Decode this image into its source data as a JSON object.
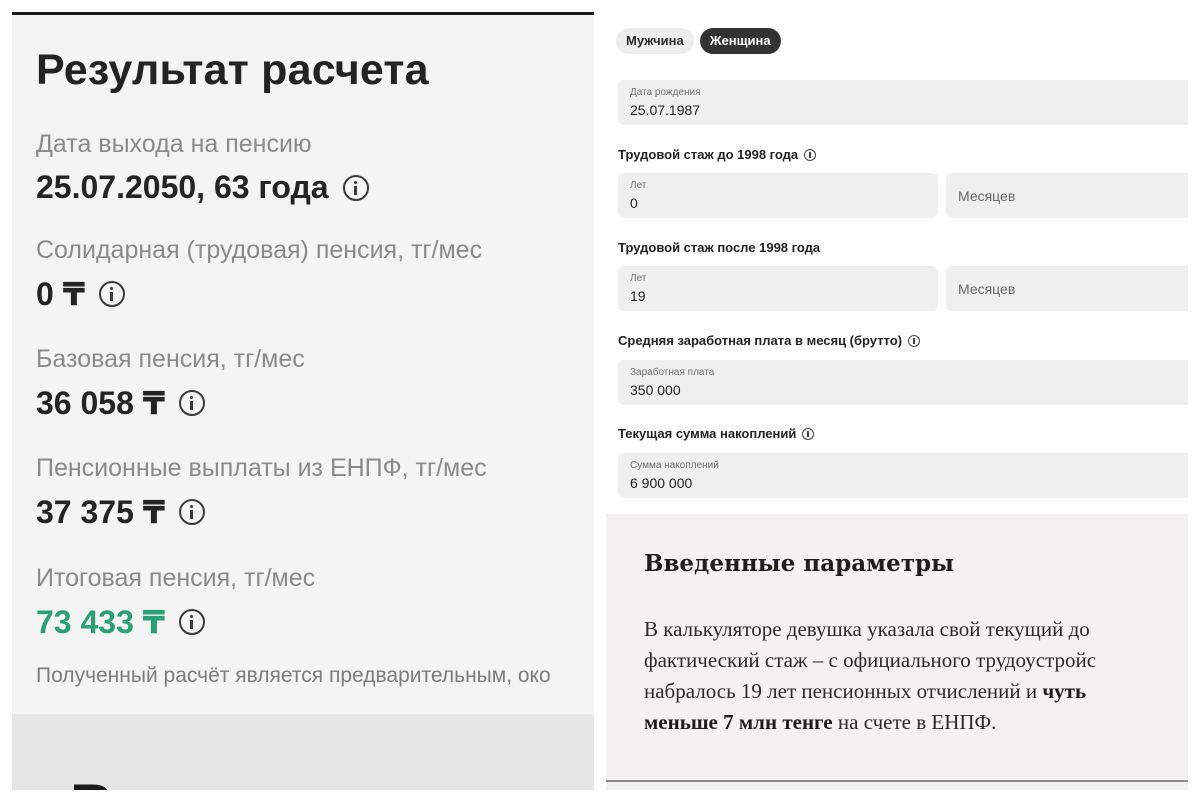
{
  "result": {
    "title": "Результат расчета",
    "items": [
      {
        "label": "Дата выхода на пенсию",
        "value": "25.07.2050, 63 года"
      },
      {
        "label": "Солидарная (трудовая) пенсия, тг/мес",
        "value": "0 ₸"
      },
      {
        "label": "Базовая пенсия, тг/мес",
        "value": "36 058 ₸"
      },
      {
        "label": "Пенсионные выплаты из ЕНПФ, тг/мес",
        "value": "37 375 ₸"
      },
      {
        "label": "Итоговая пенсия, тг/мес",
        "value": "73 433 ₸"
      }
    ],
    "disclaimer": "Полученный расчёт является предварительным, око",
    "total_color": "#2aa171",
    "cut_heading": "В"
  },
  "form": {
    "gender": {
      "options": [
        "Мужчина",
        "Женщина"
      ],
      "selected": "Женщина"
    },
    "birth": {
      "label": "Дата рождения",
      "value": "25.07.1987"
    },
    "before1998": {
      "title": "Трудовой стаж до 1998 года",
      "years_label": "Лет",
      "years_value": "0",
      "months_placeholder": "Месяцев"
    },
    "after1998": {
      "title": "Трудовой стаж после 1998 года",
      "years_label": "Лет",
      "years_value": "19",
      "months_placeholder": "Месяцев"
    },
    "salary": {
      "title": "Средняя заработная плата в месяц (брутто)",
      "label": "Заработная плата",
      "value": "350 000"
    },
    "savings": {
      "title": "Текущая сумма накоплений",
      "label": "Сумма накоплений",
      "value": "6 900 000"
    }
  },
  "article": {
    "heading": "Введенные параметры",
    "line1": "В калькуляторе девушка указала свой текущий до",
    "line2": "фактический стаж – с официального трудоустройс",
    "line3_start": "набралось 19 лет пенсионных отчислений и ",
    "line3_bold": "чуть",
    "line4_bold": "меньше 7 млн тенге",
    "line4_end": " на счете в ЕНПФ."
  }
}
